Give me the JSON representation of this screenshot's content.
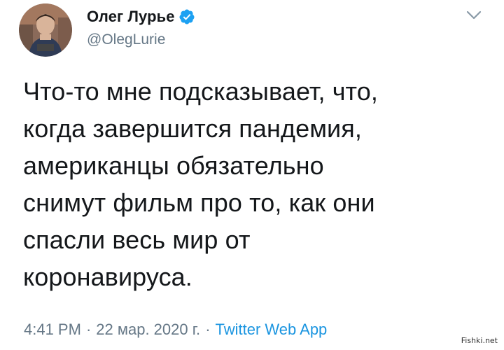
{
  "user": {
    "display_name": "Олег Лурье",
    "handle": "@OlegLurie",
    "verified": true,
    "avatar_icon": "profile-photo"
  },
  "menu": {
    "icon": "chevron-down-icon"
  },
  "tweet": {
    "text": "Что-то мне подсказывает, что,\nкогда завершится пандемия,\nамериканцы обязательно\nснимут фильм про то, как они\nспасли весь мир от\nкоронавируса."
  },
  "meta": {
    "time": "4:41 PM",
    "date": "22 мар. 2020 г.",
    "separator": "·",
    "source": "Twitter Web App"
  },
  "watermark": {
    "text": "Fishki.net"
  },
  "colors": {
    "text_primary": "#14171a",
    "text_secondary": "#657786",
    "link": "#1b95e0",
    "verified_badge": "#1da1f2"
  }
}
